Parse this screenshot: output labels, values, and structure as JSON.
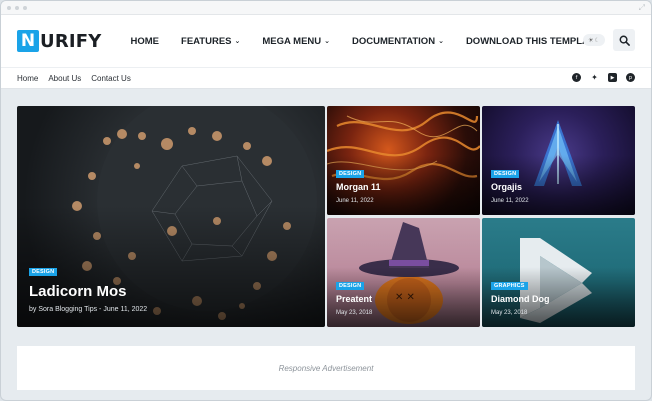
{
  "logo": {
    "letter": "N",
    "text": "URIFY"
  },
  "nav": [
    {
      "label": "HOME",
      "dropdown": false
    },
    {
      "label": "FEATURES",
      "dropdown": true
    },
    {
      "label": "MEGA MENU",
      "dropdown": true
    },
    {
      "label": "DOCUMENTATION",
      "dropdown": true
    },
    {
      "label": "DOWNLOAD THIS TEMPLATE",
      "dropdown": false
    }
  ],
  "subnav": {
    "links": [
      "Home",
      "About Us",
      "Contact Us"
    ]
  },
  "socials": [
    "facebook-icon",
    "twitter-icon",
    "youtube-icon",
    "pinterest-icon"
  ],
  "featured": {
    "big": {
      "badge": "DESIGN",
      "title": "Ladicorn Mos",
      "meta": "by Sora Blogging Tips - June 11, 2022"
    },
    "cards": [
      {
        "badge": "DESIGN",
        "title": "Morgan 11",
        "date": "June 11, 2022"
      },
      {
        "badge": "DESIGN",
        "title": "Orgajis",
        "date": "June 11, 2022"
      },
      {
        "badge": "DESIGN",
        "title": "Preatent",
        "date": "May 23, 2018"
      },
      {
        "badge": "GRAPHICS",
        "title": "Diamond Dog",
        "date": "May 23, 2018"
      }
    ]
  },
  "ad": {
    "label": "Responsive Advertisement"
  },
  "colors": {
    "accent": "#1aa3e8",
    "dark": "#1b1f24",
    "page_bg": "#e6ebef"
  }
}
